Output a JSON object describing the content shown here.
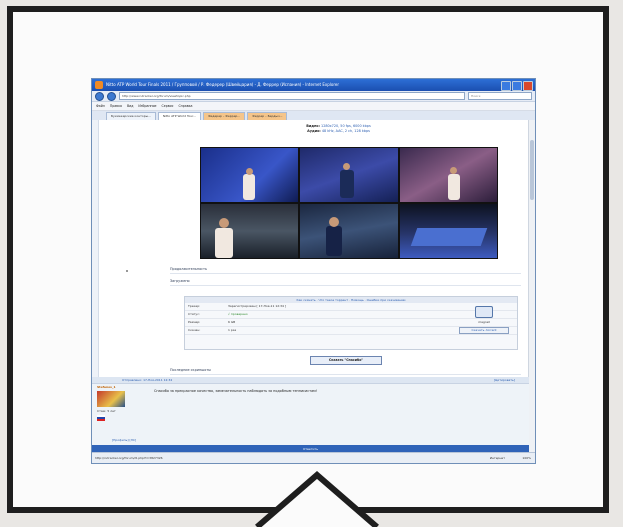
{
  "browser": {
    "title": "Nitto ATP World Tour Finals 2011 / Групповой / Р. Федерер (Швейцария) - Д. Феррер (Испания) - Internet Explorer",
    "address": "http://www.rutracker.org/forum/viewtopic.php",
    "search_placeholder": "Поиск",
    "menu": [
      "Файл",
      "Правка",
      "Вид",
      "Избранное",
      "Сервис",
      "Справка"
    ],
    "tabs": [
      {
        "label": "Букмекерские конторы...",
        "active": false,
        "orange": false
      },
      {
        "label": "Nitto ATP World Tour...",
        "active": true,
        "orange": false
      },
      {
        "label": "Федерер – Феррер...",
        "active": false,
        "orange": true
      },
      {
        "label": "Феррер – Бердыч...",
        "active": false,
        "orange": true
      }
    ],
    "status_url": "http://rutracker.org/forum/dl.php?t=3827326",
    "status_zone": "Интернет",
    "status_zoom": "100%"
  },
  "video_info": {
    "video_label": "Видео:",
    "video_value": "1280x720, 50 fps, 6000 kbps",
    "audio_label": "Аудио:",
    "audio_value": "48 kHz, AAC, 2 ch, 128 kbps"
  },
  "sections": {
    "section1": "Продолжительность",
    "section2": "Загружено",
    "section3": "Последние скриншоты"
  },
  "download": {
    "top_link": "Как скачать · Что такое торрент · Помощь · Ошибки при скачивании",
    "rows": [
      {
        "k": "Трекер:",
        "v": "Зарегистрирован  [ 17-Ноя-11 12:34 ]",
        "green": false
      },
      {
        "k": "Статус:",
        "v": "√ проверено",
        "green": true
      },
      {
        "k": "Размер:",
        "v": "6 GB",
        "green": false
      },
      {
        "k": "Скачан:",
        "v": "1 раз",
        "green": false
      }
    ],
    "side_caption": "magnet",
    "side_button": "Скачать .torrent"
  },
  "thanks_button": "Сказать \"Спасибо\"",
  "post": {
    "head_left": "Отправлено: 17-Ноя-2011 12:34",
    "head_right": "[Цитировать]",
    "author": "Stefanos_1",
    "author_meta": "Стаж: 5 лет",
    "text": "Спасибо за прекрасное качество, замечательность наблюдать за подобным теннисистам!",
    "profile_links": "[Профиль]  [ЛС]",
    "footer": "Ответить"
  }
}
